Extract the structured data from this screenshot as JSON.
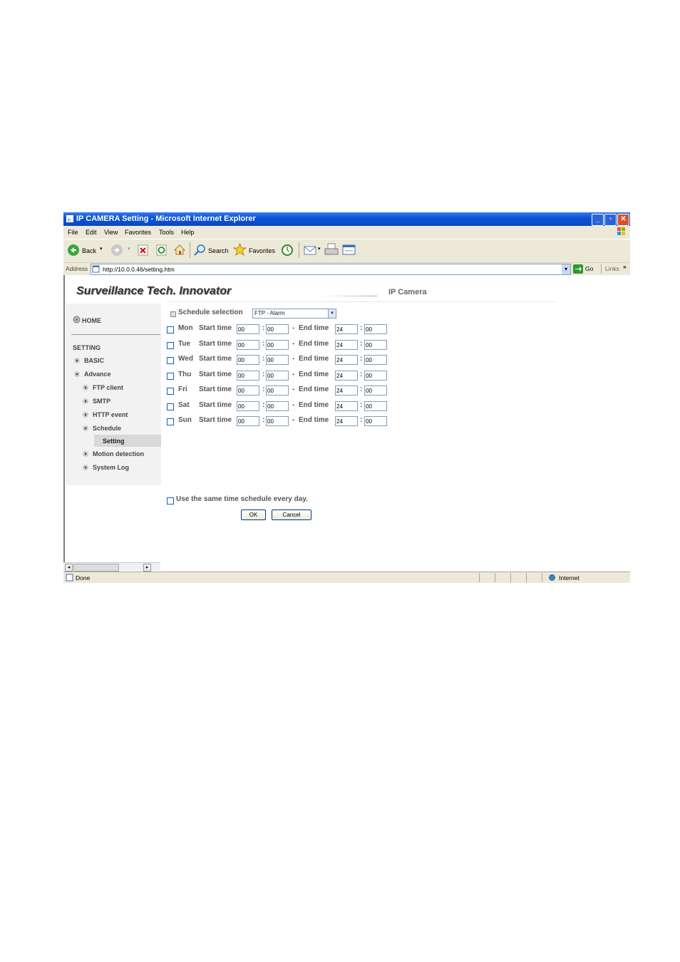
{
  "window": {
    "title": "IP CAMERA Setting - Microsoft Internet Explorer"
  },
  "menu": [
    "File",
    "Edit",
    "View",
    "Favorites",
    "Tools",
    "Help"
  ],
  "toolbar": {
    "back": "Back",
    "search": "Search",
    "favorites": "Favorites"
  },
  "address": {
    "label": "Address",
    "url": "http://10.0.0.46/setting.htm",
    "go": "Go",
    "links": "Links"
  },
  "header": {
    "brand": "Surveillance Tech. Innovator",
    "product": "IP Camera"
  },
  "sidebar": {
    "home": "HOME",
    "section": "SETTING",
    "basic": "BASIC",
    "advance": "Advance",
    "ftp_client": "FTP client",
    "smtp": "SMTP",
    "http_event": "HTTP event",
    "schedule": "Schedule",
    "setting": "Setting",
    "motion": "Motion detection",
    "syslog": "System Log"
  },
  "form": {
    "schedule_label": "Schedule selection",
    "schedule_value": "FTP - Alarm",
    "start_label": "Start time",
    "end_label": "End time",
    "colon": ":",
    "dash": "-",
    "days": [
      {
        "day": "Mon",
        "start_h": "00",
        "start_m": "00",
        "end_h": "24",
        "end_m": "00"
      },
      {
        "day": "Tue",
        "start_h": "00",
        "start_m": "00",
        "end_h": "24",
        "end_m": "00"
      },
      {
        "day": "Wed",
        "start_h": "00",
        "start_m": "00",
        "end_h": "24",
        "end_m": "00"
      },
      {
        "day": "Thu",
        "start_h": "00",
        "start_m": "00",
        "end_h": "24",
        "end_m": "00"
      },
      {
        "day": "Fri",
        "start_h": "00",
        "start_m": "00",
        "end_h": "24",
        "end_m": "00"
      },
      {
        "day": "Sat",
        "start_h": "00",
        "start_m": "00",
        "end_h": "24",
        "end_m": "00"
      },
      {
        "day": "Sun",
        "start_h": "00",
        "start_m": "00",
        "end_h": "24",
        "end_m": "00"
      }
    ],
    "same_schedule": "Use the same time schedule every day.",
    "ok": "OK",
    "cancel": "Cancel"
  },
  "status": {
    "left": "Done",
    "zone": "Internet"
  }
}
